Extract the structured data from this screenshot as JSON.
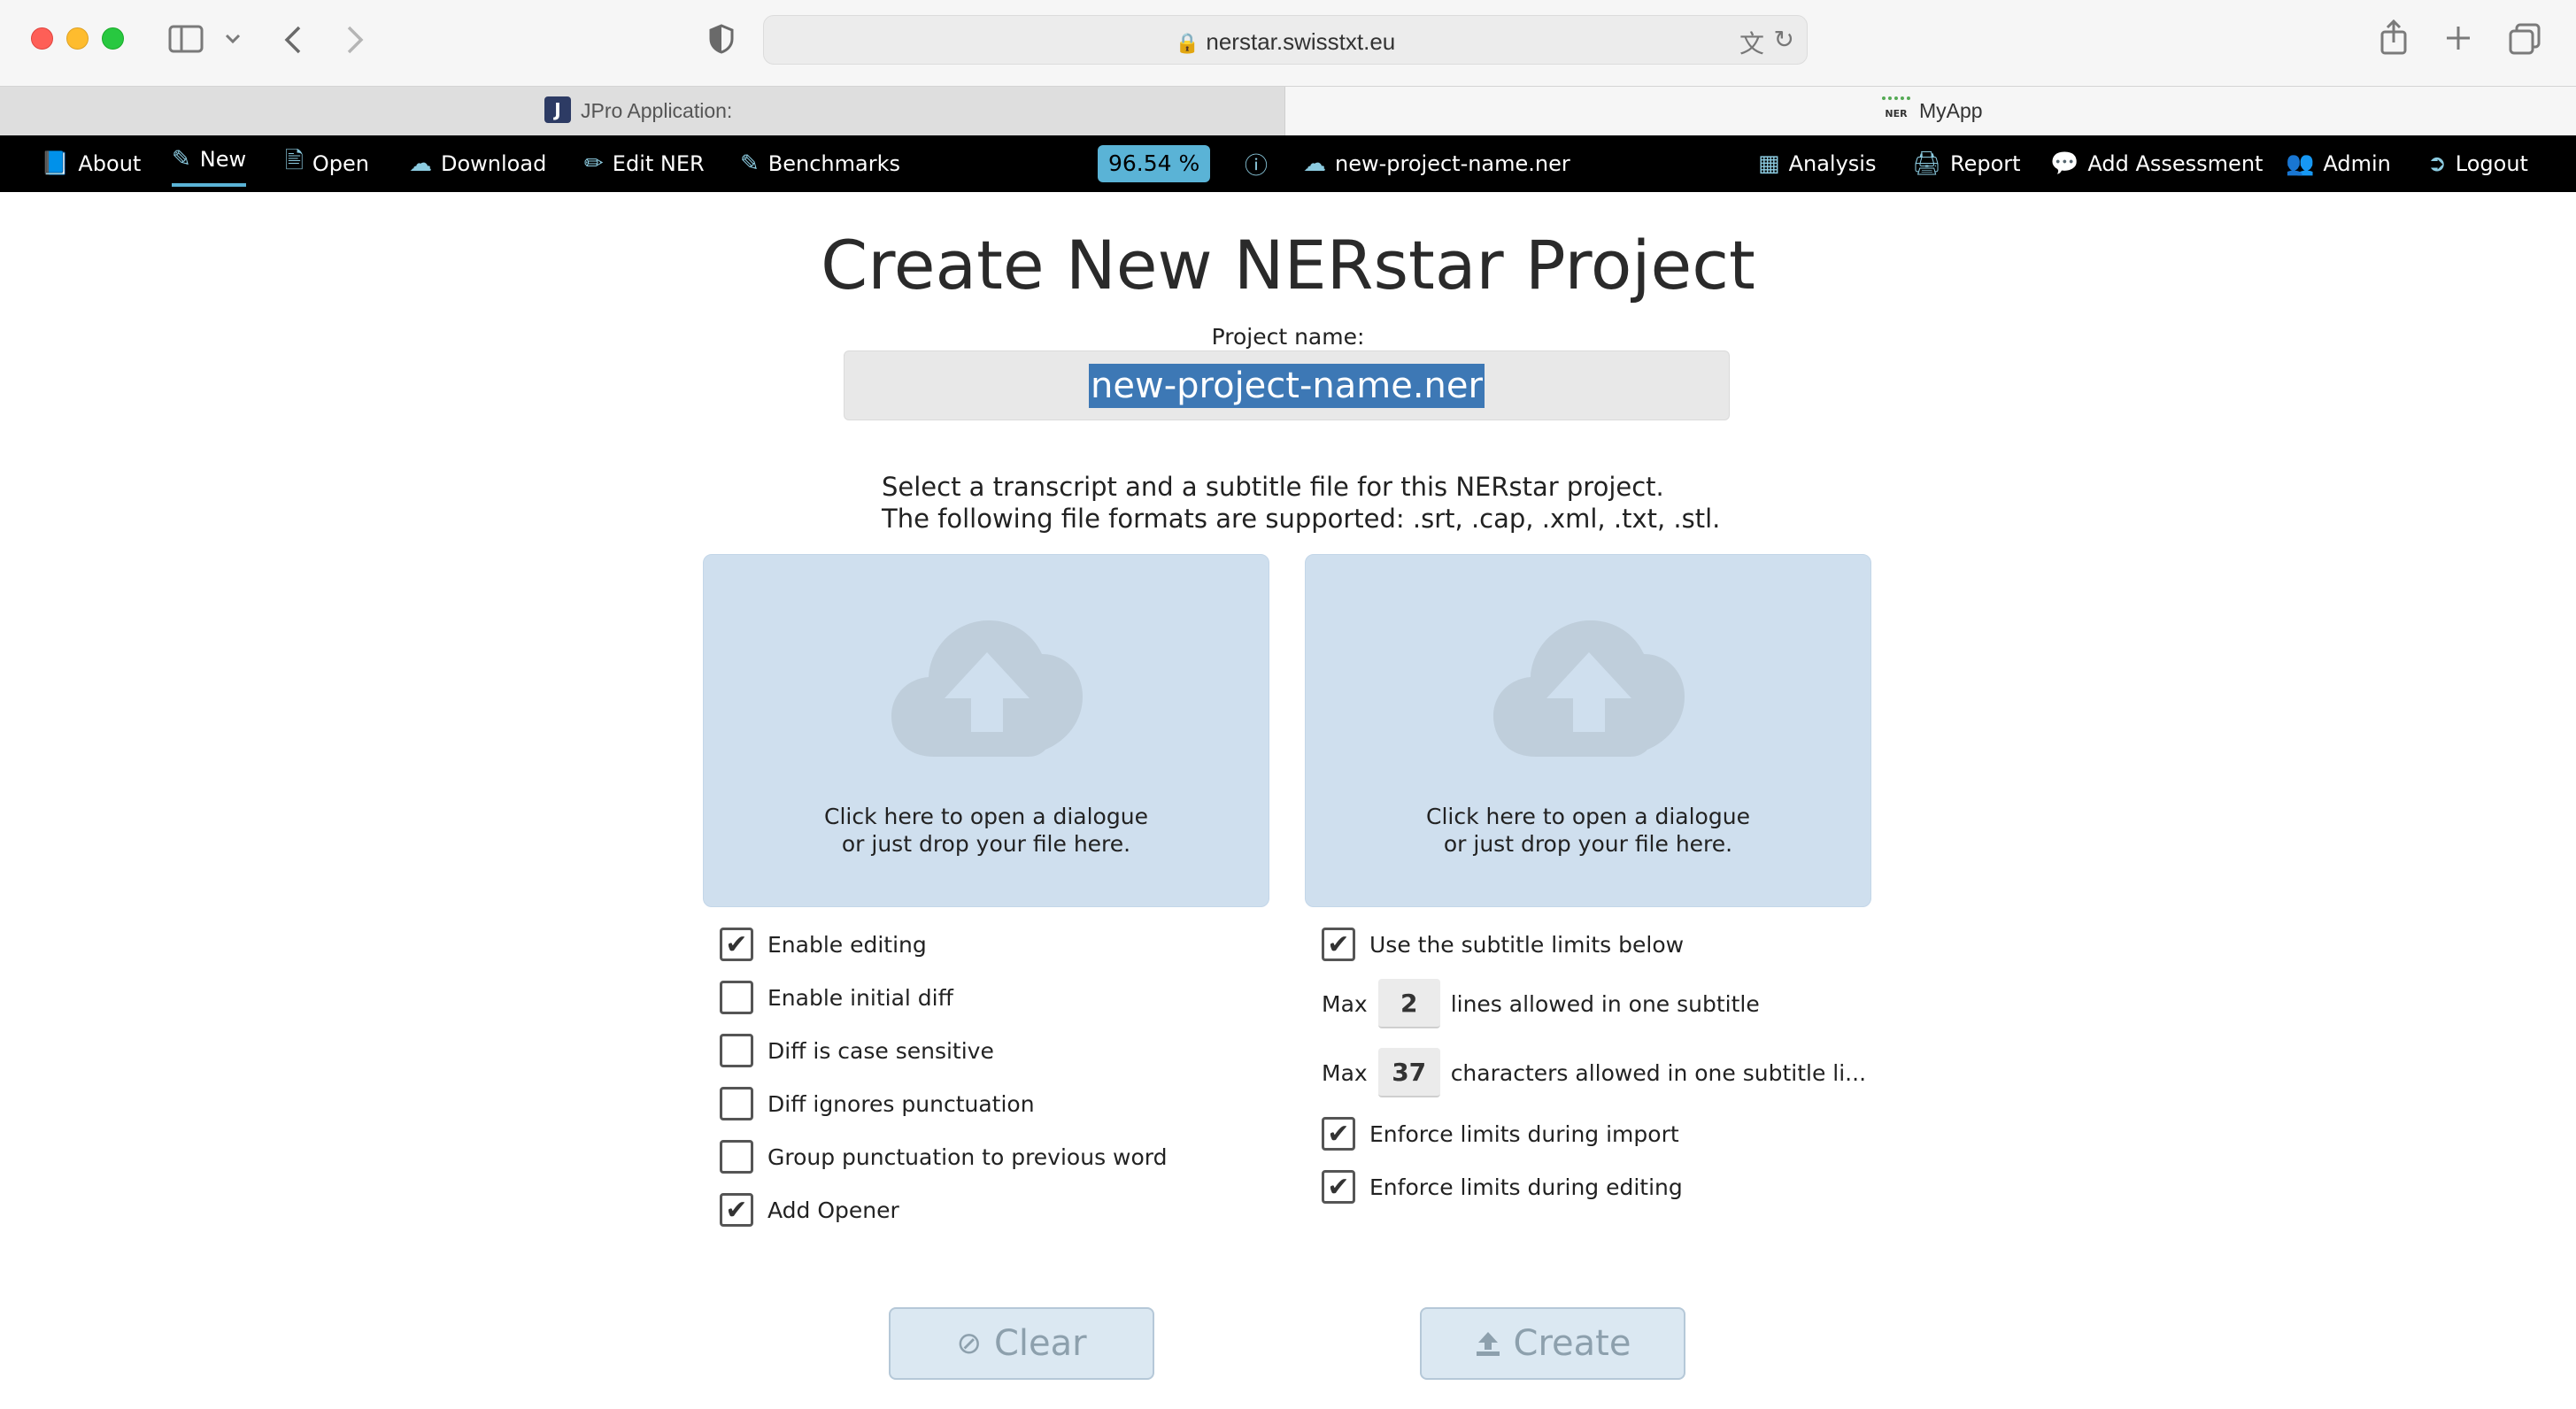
{
  "browser": {
    "url": "nerstar.swisstxt.eu",
    "tabs": [
      {
        "label": "JPro Application:",
        "favicon": "J"
      },
      {
        "label": "MyApp",
        "favicon": "NER"
      }
    ]
  },
  "nav": {
    "left": [
      {
        "label": "About",
        "icon": "book-icon"
      },
      {
        "label": "New",
        "icon": "new-document-icon"
      },
      {
        "label": "Open",
        "icon": "file-icon"
      },
      {
        "label": "Download",
        "icon": "cloud-download-icon"
      },
      {
        "label": "Edit NER",
        "icon": "pencil-icon"
      },
      {
        "label": "Benchmarks",
        "icon": "edit-square-icon"
      }
    ],
    "score": "96.54 %",
    "project_file": "new-project-name.ner",
    "right": [
      {
        "label": "Analysis",
        "icon": "table-icon"
      },
      {
        "label": "Report",
        "icon": "printer-icon"
      },
      {
        "label": "Add Assessment",
        "icon": "comment-icon"
      },
      {
        "label": "Admin",
        "icon": "users-icon"
      },
      {
        "label": "Logout",
        "icon": "logout-icon"
      }
    ]
  },
  "main": {
    "title": "Create New NERstar Project",
    "project_name_label": "Project name:",
    "project_name_value": "new-project-name.ner",
    "info_line1": "Select a transcript and a subtitle file for this NERstar project.",
    "info_line2": "The following file formats are supported: .srt, .cap, .xml, .txt, .stl.",
    "drop_line1": "Click here to open a dialogue",
    "drop_line2": "or just drop your file here."
  },
  "left_options": [
    {
      "label": "Enable editing",
      "checked": true
    },
    {
      "label": "Enable initial diff",
      "checked": false
    },
    {
      "label": "Diff is case sensitive",
      "checked": false
    },
    {
      "label": "Diff ignores punctuation",
      "checked": false
    },
    {
      "label": "Group punctuation to previous word",
      "checked": false
    },
    {
      "label": "Add Opener",
      "checked": true
    }
  ],
  "right_options": {
    "use_limits": {
      "label": "Use the subtitle limits below",
      "checked": true
    },
    "max_label": "Max",
    "max_lines": {
      "value": "2",
      "suffix": "lines allowed in one subtitle"
    },
    "max_chars": {
      "value": "37",
      "suffix": "characters allowed in one subtitle li..."
    },
    "enforce_import": {
      "label": "Enforce limits during import",
      "checked": true
    },
    "enforce_editing": {
      "label": "Enforce limits during editing",
      "checked": true
    }
  },
  "buttons": {
    "clear": "Clear",
    "create": "Create"
  },
  "check_mark": "✔"
}
